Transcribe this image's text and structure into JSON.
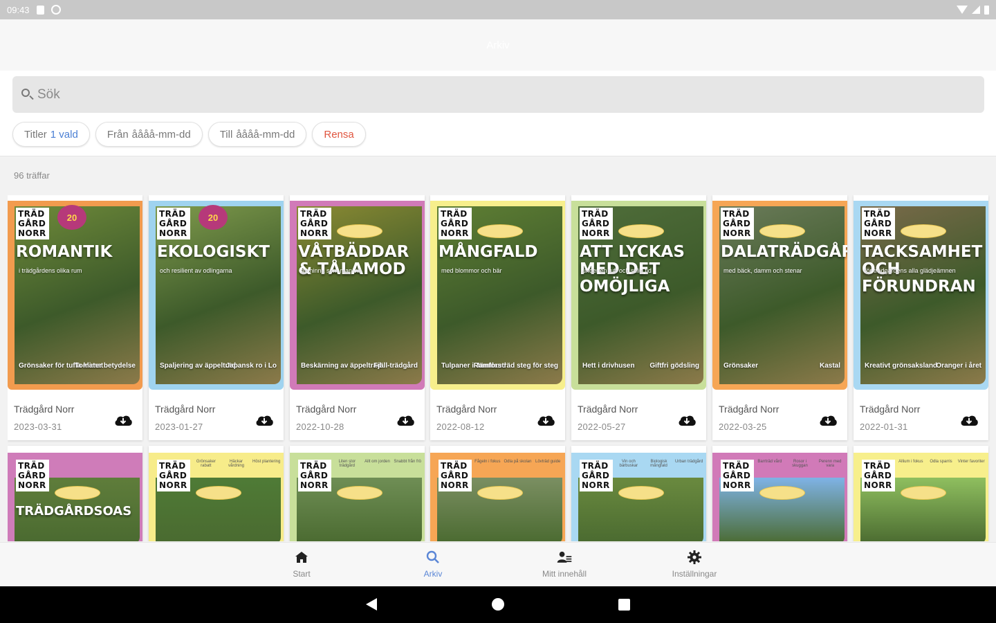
{
  "status_bar": {
    "time": "09:43"
  },
  "header": {
    "title": "Arkiv"
  },
  "search": {
    "placeholder": "Sök",
    "value": ""
  },
  "filters": {
    "titles_label": "Titler",
    "titles_selected": "1 vald",
    "from_label": "Från",
    "from_placeholder": "åååå-mm-dd",
    "to_label": "Till",
    "to_placeholder": "åååå-mm-dd",
    "clear_label": "Rensa"
  },
  "results": {
    "count_text": "96 träffar"
  },
  "issues": [
    {
      "logo": "TRÄD GÅRD NORR",
      "title": "Trädgård Norr",
      "date": "2023-03-31",
      "headline": "ROMANTIK",
      "subline": "i trädgårdens olika rum",
      "teaser_left": "Grönsaker för tuffa klimat",
      "teaser_right": "Tomater betydelse",
      "anniversary": "20",
      "frame_color": "#f29b4e",
      "photo_color": "#6f8a3a"
    },
    {
      "logo": "TRÄD GÅRD NORR",
      "title": "Trädgård Norr",
      "date": "2023-01-27",
      "headline": "EKOLOGISKT",
      "subline": "och resilient av odlingarna",
      "teaser_left": "Spaljering av äppelträd",
      "teaser_right": "Japansk ro i Lo",
      "anniversary": "20",
      "frame_color": "#9fd3ef",
      "photo_color": "#7f9a4c"
    },
    {
      "logo": "TRÄD GÅRD NORR",
      "title": "Trädgård Norr",
      "date": "2022-10-28",
      "headline": "VÅTBÄDDAR & TÅLAMOD",
      "subline": "att hinna som man vill",
      "teaser_left": "Beskärning av äppelträd",
      "teaser_right": "Fjäll-trädgård",
      "anniversary": "",
      "frame_color": "#d17ab8",
      "photo_color": "#8b8a33"
    },
    {
      "logo": "TRÄD GÅRD NORR",
      "title": "Trädgård Norr",
      "date": "2022-08-12",
      "headline": "MÅNGFALD",
      "subline": "med blommor och bär",
      "teaser_left": "Tulpaner i Jämtland",
      "teaser_right": "Ramforsträd steg för steg",
      "anniversary": "",
      "frame_color": "#f7ef8c",
      "photo_color": "#5f7f34"
    },
    {
      "logo": "TRÄD GÅRD NORR",
      "title": "Trädgård Norr",
      "date": "2022-05-27",
      "headline": "ATT LYCKAS MED DET OMÖJLIGA",
      "subline": "under en tuff och stilig tid",
      "teaser_left": "Hett i drivhusen",
      "teaser_right": "Giftfri gödsling",
      "anniversary": "",
      "frame_color": "#c8df9a",
      "photo_color": "#4f6d3a"
    },
    {
      "logo": "TRÄD GÅRD NORR",
      "title": "Trädgård Norr",
      "date": "2022-03-25",
      "headline": "DALATRÄDGÅRD",
      "subline": "med bäck, damm och stenar",
      "teaser_left": "Grönsaker",
      "teaser_right": "Kastal",
      "anniversary": "",
      "frame_color": "#f6a655",
      "photo_color": "#6b7b5a"
    },
    {
      "logo": "TRÄD GÅRD NORR",
      "title": "Trädgård Norr",
      "date": "2022-01-31",
      "headline": "TACKSAMHET OCH FÖRUNDRAN",
      "subline": "för trädgårdens alla glädjeämnen",
      "teaser_left": "Kreativt grönsaksland",
      "teaser_right": "Oranger i året",
      "anniversary": "",
      "frame_color": "#a9d8f2",
      "photo_color": "#7a6a4a"
    }
  ],
  "issues_row2": [
    {
      "logo": "TRÄD GÅRD NORR",
      "headline": "TRÄDGÅRDSOAS",
      "strip": [],
      "frame_color": "#cf7cb9",
      "photo_color": "#5f7d3b"
    },
    {
      "logo": "TRÄD GÅRD NORR",
      "headline": "",
      "strip": [
        "Grönsaker rabatt",
        "Häckar vårdning",
        "Höst plantering"
      ],
      "frame_color": "#f7ec8a",
      "photo_color": "#4f7b36"
    },
    {
      "logo": "TRÄD GÅRD NORR",
      "headline": "",
      "strip": [
        "Liten stor trädgård",
        "Allt om jorden",
        "Snabbt från frö"
      ],
      "frame_color": "#c8df9a",
      "photo_color": "#6f8e55"
    },
    {
      "logo": "TRÄD GÅRD NORR",
      "headline": "",
      "strip": [
        "Fågeln i fokus",
        "Odla på skolan",
        "Lövträd guide"
      ],
      "frame_color": "#f6a655",
      "photo_color": "#7b8f62"
    },
    {
      "logo": "TRÄD GÅRD NORR",
      "headline": "",
      "strip": [
        "Vin och bärbuskar",
        "Biologisk mångfald",
        "Urban trädgård"
      ],
      "frame_color": "#a9d8f2",
      "photo_color": "#6a8a3f"
    },
    {
      "logo": "TRÄD GÅRD NORR",
      "headline": "",
      "strip": [
        "Barrträd vård",
        "Rosor i skuggan",
        "Perenn med vara"
      ],
      "frame_color": "#d17ab8",
      "photo_color": "#7fb3e6"
    },
    {
      "logo": "TRÄD GÅRD NORR",
      "headline": "",
      "strip": [
        "Allium i fokus",
        "Odla sparris",
        "Vinter favoriter"
      ],
      "frame_color": "#f7ef8c",
      "photo_color": "#8fbf5f"
    }
  ],
  "bottom_nav": {
    "items": [
      {
        "label": "Start",
        "icon": "home-icon"
      },
      {
        "label": "Arkiv",
        "icon": "search-icon"
      },
      {
        "label": "Mitt innehåll",
        "icon": "user-content-icon"
      },
      {
        "label": "Inställningar",
        "icon": "gear-icon"
      }
    ],
    "active_index": 1,
    "active_color": "#5a86d6"
  },
  "colors": {
    "chip_accent": "#4a7fd4",
    "clear": "#e0553f"
  }
}
